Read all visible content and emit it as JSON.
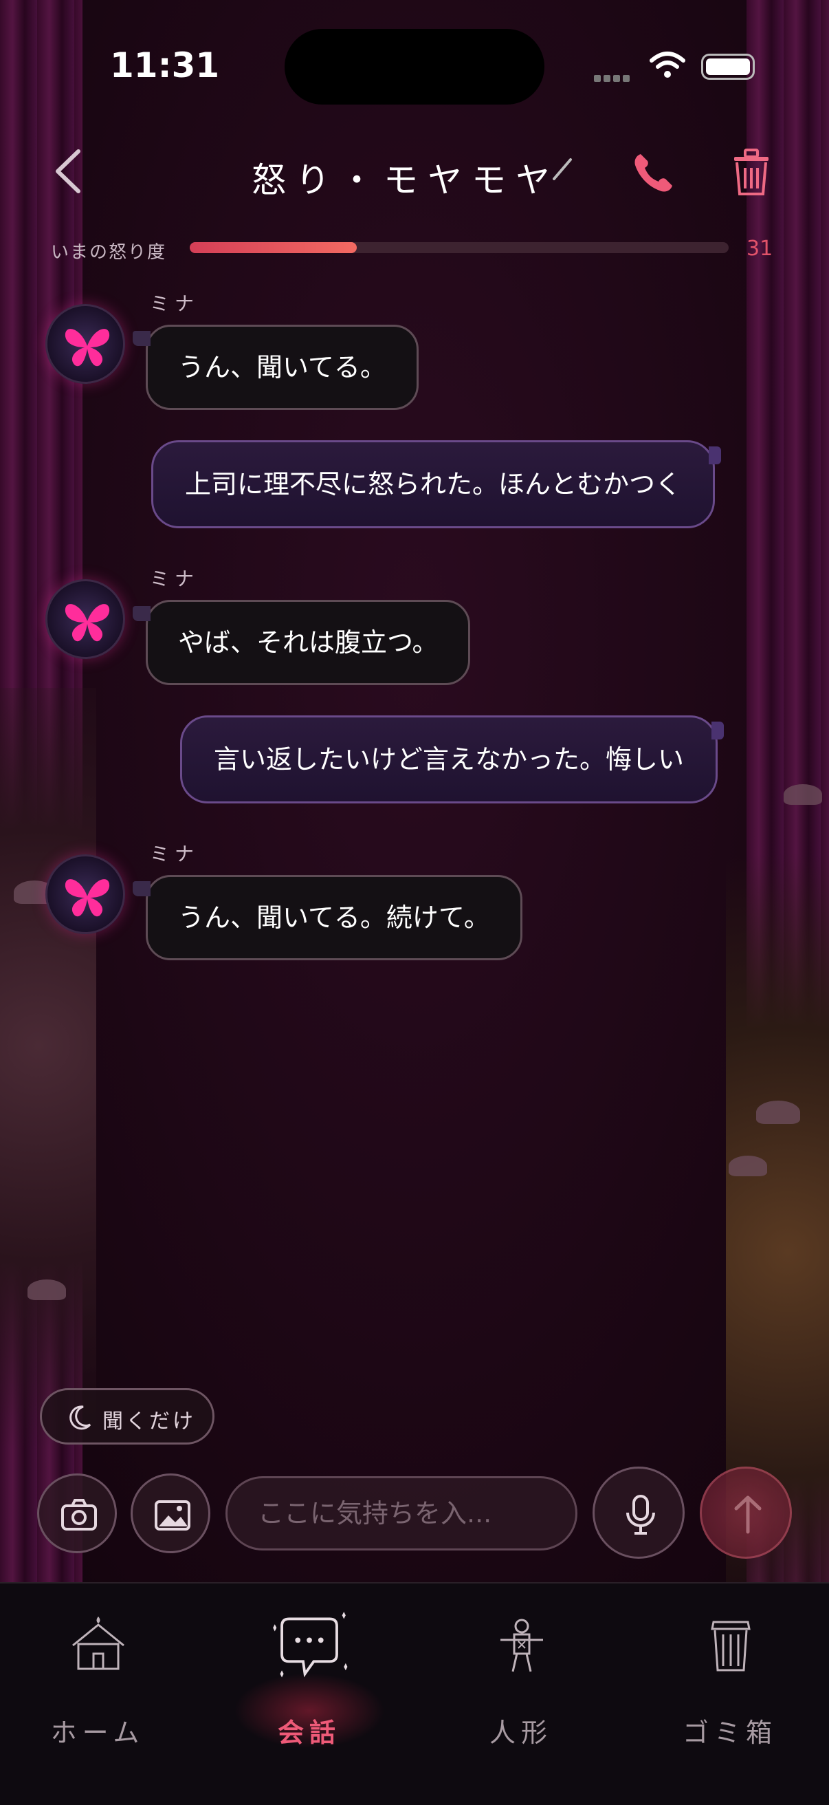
{
  "status_bar": {
    "time": "11:31"
  },
  "header": {
    "title": "怒り・モヤモヤ"
  },
  "anger_meter": {
    "label": "いまの怒り度",
    "value": "31",
    "fraction": 0.31
  },
  "messages": [
    {
      "side": "in",
      "sender": "ミナ",
      "text": "うん、聞いてる。"
    },
    {
      "side": "out",
      "text": "上司に理不尽に怒られた。ほんとむかつく"
    },
    {
      "side": "in",
      "sender": "ミナ",
      "text": "やば、それは腹立つ。"
    },
    {
      "side": "out",
      "text": "言い返したいけど言えなかった。悔しい"
    },
    {
      "side": "in",
      "sender": "ミナ",
      "text": "うん、聞いてる。続けて。"
    }
  ],
  "listen_only": {
    "label": "聞くだけ"
  },
  "composer": {
    "placeholder": "ここに気持ちを入..."
  },
  "tabs": [
    {
      "label": "ホーム",
      "icon": "house-icon",
      "active": false
    },
    {
      "label": "会話",
      "icon": "chat-bubble-icon",
      "active": true
    },
    {
      "label": "人形",
      "icon": "doll-icon",
      "active": false
    },
    {
      "label": "ゴミ箱",
      "icon": "trash-can-icon",
      "active": false
    }
  ],
  "colors": {
    "accent": "#ee5a78",
    "meter_fill": "#f36a62",
    "background": "#1a0812"
  }
}
